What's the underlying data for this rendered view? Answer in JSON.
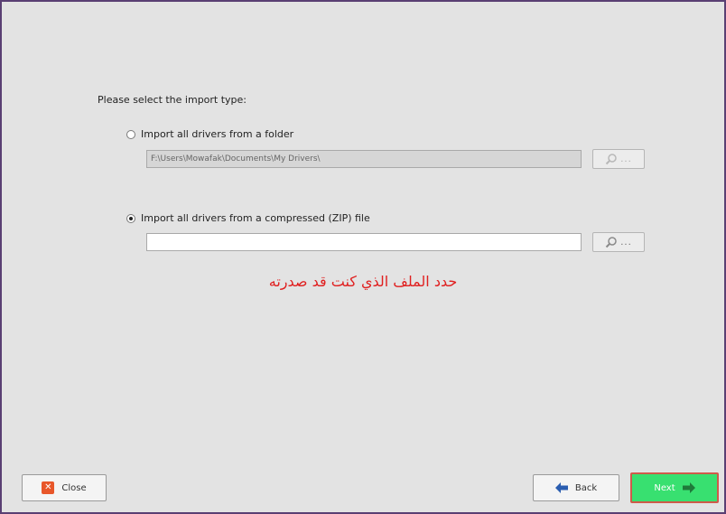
{
  "heading": "Please select the import type:",
  "options": [
    {
      "label": "Import all drivers from a folder",
      "selected": false,
      "path_value": "F:\\Users\\Mowafak\\Documents\\My Drivers\\",
      "path_enabled": false
    },
    {
      "label": "Import all drivers from a compressed (ZIP) file",
      "selected": true,
      "path_value": "",
      "path_enabled": true
    }
  ],
  "browse_dots": "...",
  "annotation": "حدد الملف الذي كنت قد صدرته",
  "buttons": {
    "close": "Close",
    "back": "Back",
    "next": "Next"
  },
  "colors": {
    "annotation": "#e02020",
    "next_bg": "#38e070",
    "next_border": "#cf5a4a",
    "window_border": "#5a3f73"
  },
  "icons": {
    "browse": "magnifier-icon",
    "close": "close-icon",
    "back": "arrow-left-icon",
    "next": "arrow-right-icon"
  }
}
